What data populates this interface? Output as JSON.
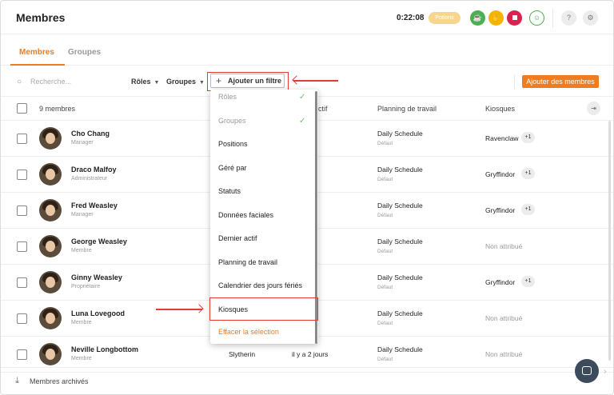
{
  "header": {
    "title": "Membres",
    "timer": "0:22:08",
    "status_pill": "Potions",
    "colors": {
      "accent": "#f07c1f",
      "green": "#4caf50",
      "yellow": "#f5b400",
      "red": "#d9234f",
      "highlight": "#e53935"
    },
    "icons": [
      "coffee-cup-icon",
      "hand-icon",
      "stop-icon",
      "user-check-icon",
      "help-icon",
      "settings-icon"
    ]
  },
  "tabs": [
    {
      "label": "Membres",
      "active": true
    },
    {
      "label": "Groupes",
      "active": false
    }
  ],
  "toolbar": {
    "search_placeholder": "Recherche...",
    "roles_label": "Rôles",
    "groups_label": "Groupes",
    "add_filter_label": "Ajouter un filtre",
    "add_members_label": "Ajouter des membres"
  },
  "table": {
    "count_label": "9 membres",
    "columns": [
      "actif",
      "Planning de travail",
      "Kiosques"
    ],
    "rows": [
      {
        "name": "Cho Chang",
        "role": "Manager",
        "group": "",
        "active": "ours",
        "schedule": "Daily Schedule",
        "schedule_sub": "Défaut",
        "kiosk": "Ravenclaw",
        "extra": "+1"
      },
      {
        "name": "Draco Malfoy",
        "role": "Administrateur",
        "group": "",
        "active": "urs",
        "schedule": "Daily Schedule",
        "schedule_sub": "Défaut",
        "kiosk": "Gryffindor",
        "extra": "+1"
      },
      {
        "name": "Fred Weasley",
        "role": "Manager",
        "group": "",
        "active": "urs",
        "schedule": "Daily Schedule",
        "schedule_sub": "Défaut",
        "kiosk": "Gryffindor",
        "extra": "+1"
      },
      {
        "name": "George Weasley",
        "role": "Membre",
        "group": "",
        "active": "ours",
        "schedule": "Daily Schedule",
        "schedule_sub": "Défaut",
        "kiosk": "Non attribué",
        "extra": ""
      },
      {
        "name": "Ginny Weasley",
        "role": "Propriétaire",
        "group": "",
        "active": "minutes",
        "schedule": "Daily Schedule",
        "schedule_sub": "Défaut",
        "kiosk": "Gryffindor",
        "extra": "+1"
      },
      {
        "name": "Luna Lovegood",
        "role": "Membre",
        "group": "",
        "active": "urs",
        "schedule": "Daily Schedule",
        "schedule_sub": "Défaut",
        "kiosk": "Non attribué",
        "extra": ""
      },
      {
        "name": "Neville Longbottom",
        "role": "Membre",
        "group": "Slytherin",
        "active": "il y a 2 jours",
        "schedule": "Daily Schedule",
        "schedule_sub": "Défaut",
        "kiosk": "Non attribué",
        "extra": ""
      }
    ]
  },
  "filter_menu": {
    "items": [
      {
        "label": "Rôles",
        "checked": true
      },
      {
        "label": "Groupes",
        "checked": true
      },
      {
        "label": "Positions",
        "checked": false
      },
      {
        "label": "Géré par",
        "checked": false
      },
      {
        "label": "Statuts",
        "checked": false
      },
      {
        "label": "Données faciales",
        "checked": false
      },
      {
        "label": "Dernier actif",
        "checked": false
      },
      {
        "label": "Planning de travail",
        "checked": false
      },
      {
        "label": "Calendrier des jours fériés",
        "checked": false
      },
      {
        "label": "Kiosques",
        "checked": false
      }
    ],
    "clear_label": "Effacer la sélection"
  },
  "footer": {
    "archived_label": "Membres archivés"
  }
}
